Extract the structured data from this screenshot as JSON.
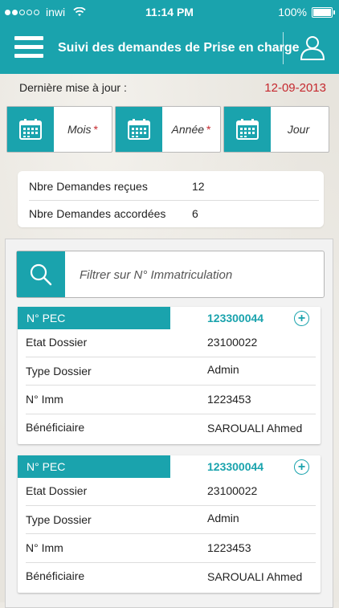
{
  "status_bar": {
    "carrier": "inwi",
    "time": "11:14 PM",
    "battery": "100%"
  },
  "header": {
    "title": "Suivi des demandes de Prise en charge",
    "accent_color": "#1aa3ad"
  },
  "update": {
    "label": "Dernière mise à jour :",
    "date": "12-09-2013",
    "date_color": "#c5282e"
  },
  "date_filters": [
    {
      "label": "Mois",
      "required": "*"
    },
    {
      "label": "Année",
      "required": "*"
    },
    {
      "label": "Jour",
      "required": ""
    }
  ],
  "stats": [
    {
      "label": "Nbre Demandes reçues",
      "value": "12"
    },
    {
      "label": "Nbre Demandes accordées",
      "value": "6"
    }
  ],
  "search": {
    "placeholder": "Filtrer sur N° Immatriculation"
  },
  "cards": [
    {
      "tag_label": "N° PEC",
      "number": "123300044",
      "rows": [
        {
          "label": "Etat Dossier",
          "value": "23100022"
        },
        {
          "label": "Type Dossier",
          "value": "Admin"
        },
        {
          "label": "N° Imm",
          "value": "1223453"
        },
        {
          "label": "Bénéficiaire",
          "value": "SAROUALI Ahmed"
        }
      ]
    },
    {
      "tag_label": "N° PEC",
      "number": "123300044",
      "rows": [
        {
          "label": "Etat Dossier",
          "value": "23100022"
        },
        {
          "label": "Type Dossier",
          "value": "Admin"
        },
        {
          "label": "N° Imm",
          "value": "1223453"
        },
        {
          "label": "Bénéficiaire",
          "value": "SAROUALI Ahmed"
        }
      ]
    }
  ]
}
